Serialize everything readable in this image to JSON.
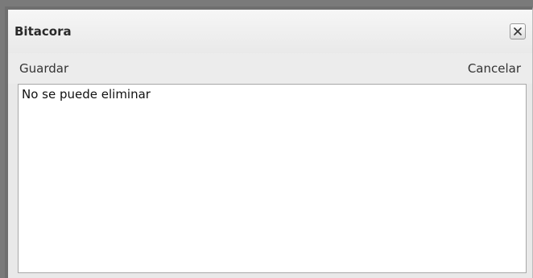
{
  "dialog": {
    "title": "Bitacora",
    "close_icon": "close-icon"
  },
  "toolbar": {
    "save_label": "Guardar",
    "cancel_label": "Cancelar"
  },
  "content": {
    "text": "No se puede eliminar"
  },
  "colors": {
    "backdrop": "#7a7a7a",
    "dialog_background": "#e9e9e9",
    "content_background": "#ffffff"
  }
}
